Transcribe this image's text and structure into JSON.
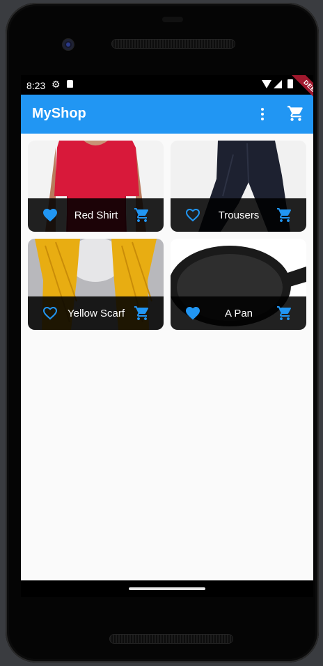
{
  "status_bar": {
    "time": "8:23"
  },
  "app_bar": {
    "title": "MyShop",
    "color": "#2196f3"
  },
  "debug_banner": "DEBUG",
  "products": [
    {
      "title": "Red Shirt",
      "favorite": true
    },
    {
      "title": "Trousers",
      "favorite": false
    },
    {
      "title": "Yellow Scarf",
      "favorite": false
    },
    {
      "title": "A Pan",
      "favorite": true
    }
  ],
  "icons": {
    "favorite": "heart-icon",
    "cart": "shopping-cart-icon",
    "menu": "more-vert-icon"
  },
  "colors": {
    "accent": "#2196f3",
    "footer": "#000000"
  }
}
